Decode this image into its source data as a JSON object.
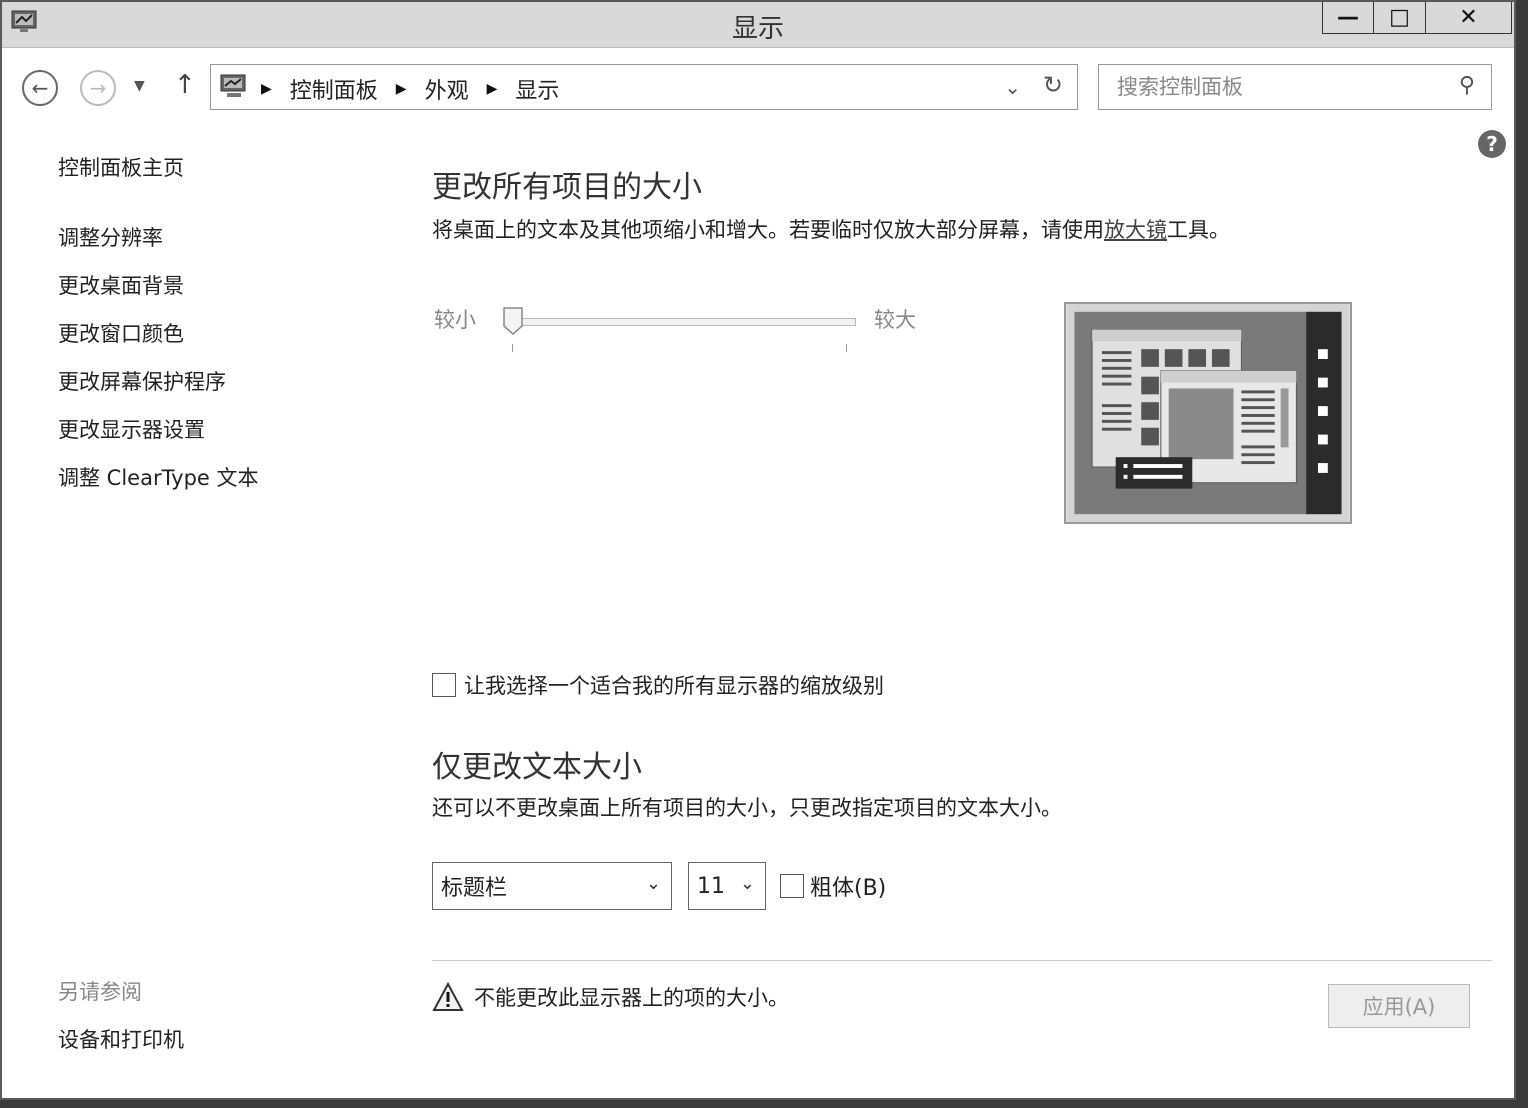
{
  "window": {
    "title": "显示",
    "minimize_glyph": "—",
    "maximize_glyph": "□",
    "close_glyph": "✕"
  },
  "nav": {
    "breadcrumbs": [
      "控制面板",
      "外观",
      "显示"
    ],
    "search_placeholder": "搜索控制面板"
  },
  "sidebar": {
    "home": "控制面板主页",
    "links": [
      "调整分辨率",
      "更改桌面背景",
      "更改窗口颜色",
      "更改屏幕保护程序",
      "更改显示器设置",
      "调整 ClearType 文本"
    ],
    "see_also_heading": "另请参阅",
    "see_also_links": [
      "设备和打印机"
    ]
  },
  "main": {
    "resize_heading": "更改所有项目的大小",
    "resize_desc_before": "将桌面上的文本及其他项缩小和增大。若要临时仅放大部分屏幕，请使用",
    "resize_desc_link": "放大镜",
    "resize_desc_after": "工具。",
    "slider": {
      "min_label": "较小",
      "max_label": "较大",
      "value": 0
    },
    "scale_checkbox_label": "让我选择一个适合我的所有显示器的缩放级别",
    "scale_checked": false,
    "text_heading": "仅更改文本大小",
    "text_desc": "还可以不更改桌面上所有项目的大小，只更改指定项目的文本大小。",
    "item_select": "标题栏",
    "size_select": "11",
    "bold_label": "粗体(B)",
    "bold_checked": false,
    "warning_text": "不能更改此显示器上的项的大小。",
    "apply_button": "应用(A)"
  }
}
